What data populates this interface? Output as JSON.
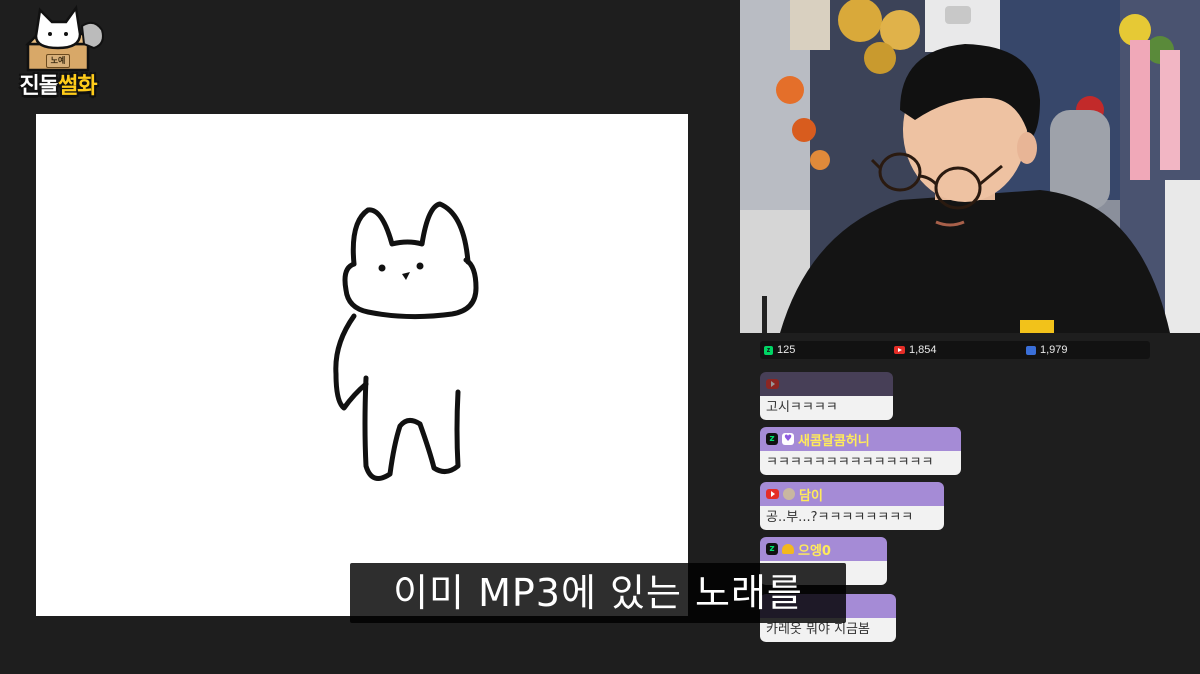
{
  "logo": {
    "text_a": "진돌",
    "text_b": "썰화",
    "tag": "노예"
  },
  "stats": {
    "chzzk_viewers": "125",
    "youtube_viewers": "1,854",
    "soop_viewers": "1,979"
  },
  "chat": [
    {
      "name": "",
      "message": "고시ㅋㅋㅋㅋ",
      "badges": [
        "youtube-icon"
      ]
    },
    {
      "name": "새콤달콤허니",
      "message": "ㅋㅋㅋㅋㅋㅋㅋㅋㅋㅋㅋㅋㅋㅋ",
      "badges": [
        "chzzk-icon",
        "heart-icon"
      ]
    },
    {
      "name": "담이",
      "message": "공..부...?ㅋㅋㅋㅋㅋㅋㅋㅋ",
      "badges": [
        "youtube-icon",
        "avatar-icon"
      ]
    },
    {
      "name": "으엥0",
      "message": "",
      "badges": [
        "chzzk-icon",
        "cheese-icon"
      ]
    },
    {
      "name": "",
      "message": "카레옷 뭐야 지금봄",
      "badges": []
    }
  ],
  "subtitle": "이미 MP3에 있는 노래를",
  "colors": {
    "chat_header": "#a58bd6",
    "chat_name": "#ffeb5a",
    "logo_accent": "#ffcc1a"
  }
}
